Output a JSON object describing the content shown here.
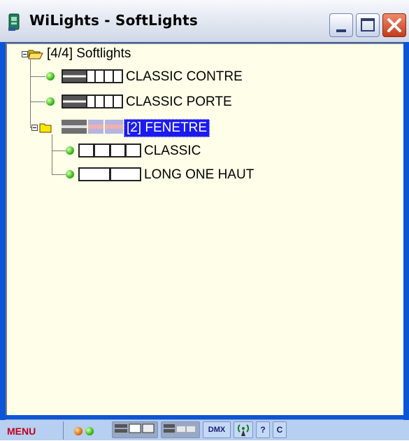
{
  "window": {
    "title": "WiLights - SoftLights",
    "controls": [
      "minimize",
      "maximize",
      "close"
    ]
  },
  "tree": {
    "root": {
      "label": "[4/4] Softlights",
      "icon": "folder-open-icon"
    },
    "items": [
      {
        "label": "CLASSIC CONTRE",
        "status": "green",
        "strip": [
          "dark",
          "dark",
          "light",
          "light",
          "light"
        ]
      },
      {
        "label": "CLASSIC PORTE",
        "status": "green",
        "strip": [
          "dark",
          "dark",
          "light",
          "light",
          "light"
        ]
      },
      {
        "label": "[2] FENETRE",
        "selected": true,
        "icon": "folder-icon",
        "children": [
          {
            "label": "CLASSIC",
            "status": "green"
          },
          {
            "label": "LONG ONE HAUT",
            "status": "green"
          }
        ]
      }
    ]
  },
  "toolbar": {
    "menu_label": "MENU",
    "dmx_label": "DMX",
    "help_label": "?",
    "c_label": "C"
  },
  "colors": {
    "selection": "#1b1bf0",
    "tree_background": "#ffffe9",
    "status_green": "#39b81a",
    "frame": "#0a55d8",
    "menu_text": "#c0001a"
  }
}
